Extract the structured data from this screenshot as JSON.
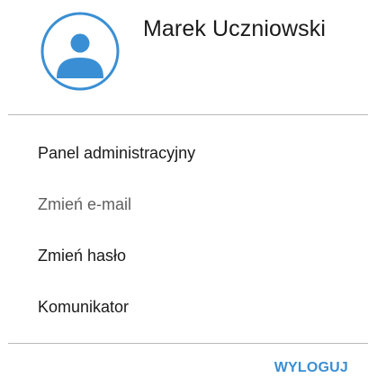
{
  "user": {
    "name": "Marek Uczniowski",
    "avatar_icon": "user-avatar-icon"
  },
  "menu": {
    "items": [
      {
        "label": "Panel administracyjny",
        "state": "normal"
      },
      {
        "label": "Zmień e-mail",
        "state": "muted"
      },
      {
        "label": "Zmień hasło",
        "state": "normal"
      },
      {
        "label": "Komunikator",
        "state": "normal"
      }
    ]
  },
  "logout_label": "WYLOGUJ",
  "colors": {
    "accent": "#3a8fd4",
    "text": "#1a1a1a",
    "muted_text": "#5f5f5f",
    "divider": "#b9b9b9"
  }
}
